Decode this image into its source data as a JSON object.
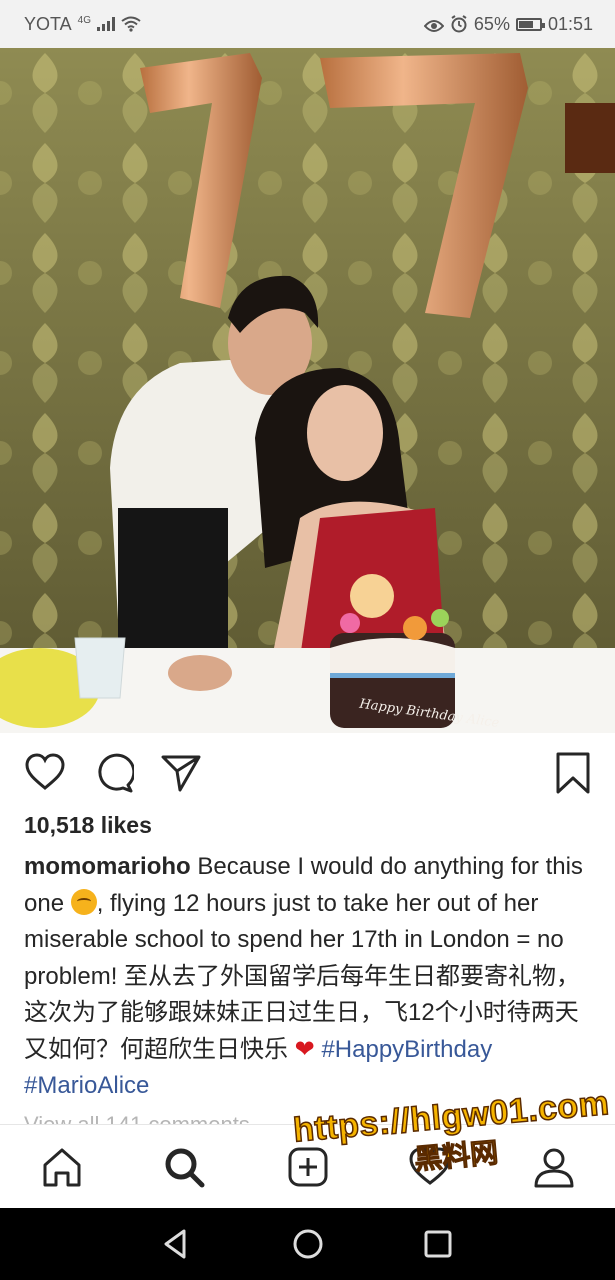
{
  "status_bar": {
    "carrier": "YOTA",
    "network": "4G",
    "battery_percent": "65%",
    "time": "01:51"
  },
  "post": {
    "likes": "10,518 likes",
    "username": "momomarioho",
    "caption_part1": " Because I would do anything for this one ",
    "caption_part2": ", flying 12 hours just to take her out of her miserable school to spend her 17th in London = no problem! 至从去了外国留学后每年生日都要寄礼物，这次为了能够跟妹妹正日过生日，飞12个小时待两天又如何？何超欣生日快乐 ",
    "heart": "❤",
    "hashtag1": "#HappyBirthday",
    "hashtag2": "#MarioAlice",
    "view_all": "View all 141 comments",
    "cake_text": "Happy Birthday Alice"
  },
  "watermark": {
    "url": "https://hlgw01.com",
    "label": "黑料网"
  },
  "colors": {
    "hashtag": "#385898",
    "heart": "#d8181f",
    "watermark": "#f5b400"
  }
}
